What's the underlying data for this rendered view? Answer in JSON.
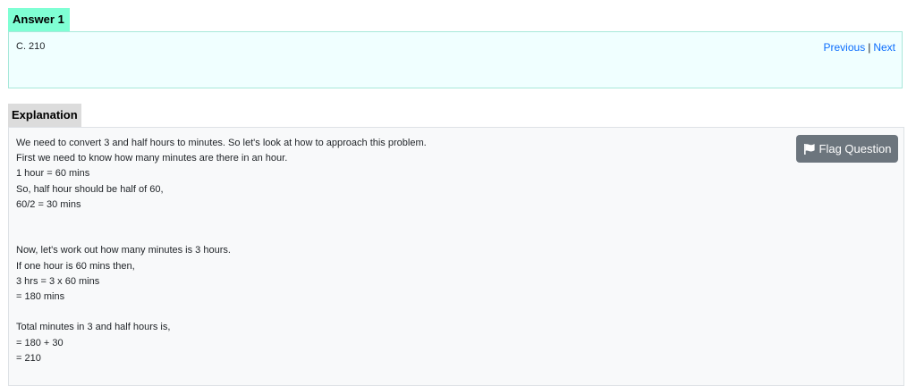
{
  "answer": {
    "title": "Answer 1",
    "value": "C. 210",
    "nav": {
      "previous": "Previous",
      "separator": "|",
      "next": "Next"
    }
  },
  "explanation": {
    "title": "Explanation",
    "flag_button": "Flag Question",
    "flag_icon": "flag-icon",
    "lines": [
      "We need to convert 3 and half hours to minutes. So let's look at how to approach this problem.",
      "First we need to know how many minutes are there in an hour.",
      "1 hour = 60 mins",
      "So, half hour should be half of 60,",
      "60/2 = 30 mins",
      "",
      "",
      "Now, let's work out how many minutes is 3 hours.",
      "If one hour is 60 mins then,",
      "3 hrs = 3 x 60 mins",
      "= 180 mins",
      "",
      "Total minutes in 3 and half hours is,",
      "= 180 + 30",
      "= 210"
    ]
  }
}
